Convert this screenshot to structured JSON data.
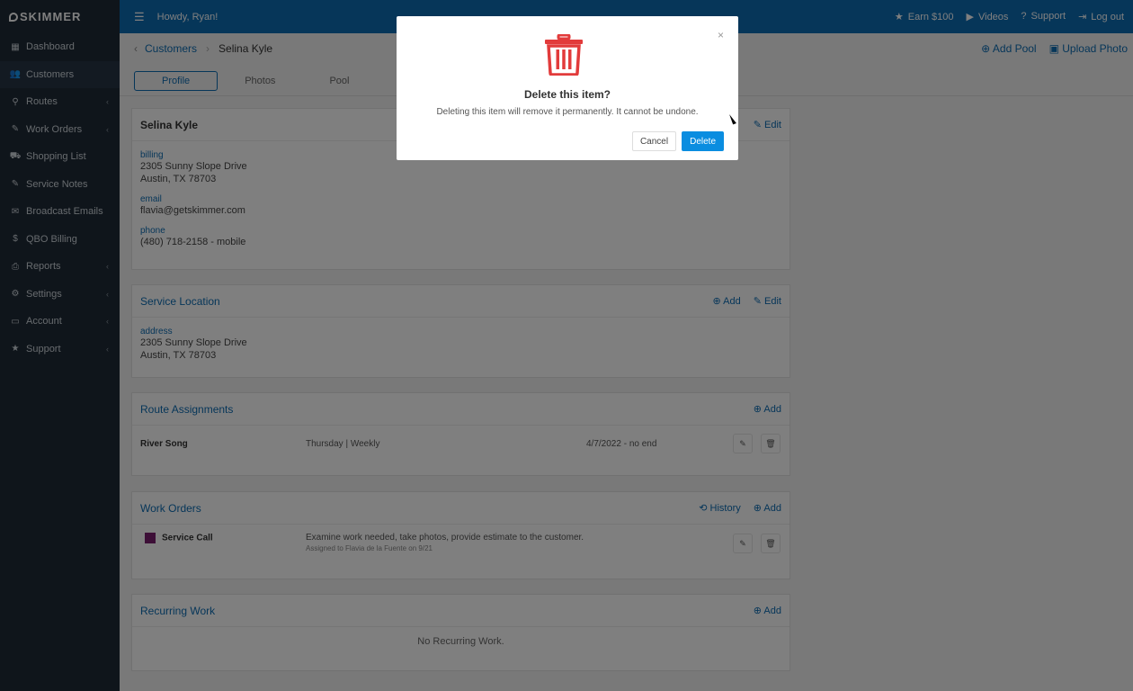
{
  "app": {
    "logo_text": "SKIMMER"
  },
  "sidebar": {
    "items": [
      {
        "label": "Dashboard",
        "icon": "dashboard-icon",
        "glyph": "▦"
      },
      {
        "label": "Customers",
        "icon": "users-icon",
        "glyph": "👥"
      },
      {
        "label": "Routes",
        "icon": "map-pin-icon",
        "glyph": "⚲"
      },
      {
        "label": "Work Orders",
        "icon": "wrench-icon",
        "glyph": "✎"
      },
      {
        "label": "Shopping List",
        "icon": "cart-icon",
        "glyph": "⛟"
      },
      {
        "label": "Service Notes",
        "icon": "edit-icon",
        "glyph": "✎"
      },
      {
        "label": "Broadcast Emails",
        "icon": "envelope-icon",
        "glyph": "✉"
      },
      {
        "label": "QBO Billing",
        "icon": "dollar-icon",
        "glyph": "$"
      },
      {
        "label": "Reports",
        "icon": "printer-icon",
        "glyph": "⎙"
      },
      {
        "label": "Settings",
        "icon": "gear-icon",
        "glyph": "⚙"
      },
      {
        "label": "Account",
        "icon": "card-icon",
        "glyph": "▭"
      },
      {
        "label": "Support",
        "icon": "star-icon",
        "glyph": "★"
      }
    ]
  },
  "topbar": {
    "howdy": "Howdy, Ryan!",
    "earn": "Earn $100",
    "videos": "Videos",
    "support": "Support",
    "logout": "Log out"
  },
  "breadcrumb": {
    "parent": "Customers",
    "current": "Selina Kyle"
  },
  "header_actions": {
    "add_pool": "Add Pool",
    "upload_photo": "Upload Photo"
  },
  "tabs": [
    "Profile",
    "Photos",
    "Pool"
  ],
  "profile": {
    "name": "Selina Kyle",
    "edit": "Edit",
    "billing_label": "billing",
    "billing_line1": "2305 Sunny Slope Drive",
    "billing_line2": "Austin, TX 78703",
    "email_label": "email",
    "email": "flavia@getskimmer.com",
    "phone_label": "phone",
    "phone": "(480) 718-2158 - mobile"
  },
  "service_location": {
    "title": "Service Location",
    "add": "Add",
    "edit": "Edit",
    "address_label": "address",
    "line1": "2305 Sunny Slope Drive",
    "line2": "Austin, TX 78703"
  },
  "route_assignments": {
    "title": "Route Assignments",
    "add": "Add",
    "rows": [
      {
        "tech": "River Song",
        "schedule": "Thursday | Weekly",
        "dates": "4/7/2022 - no end"
      }
    ]
  },
  "work_orders": {
    "title": "Work Orders",
    "history": "History",
    "add": "Add",
    "rows": [
      {
        "type": "Service Call",
        "description": "Examine work needed, take photos, provide estimate to the customer.",
        "assigned": "Assigned to Flavia de la Fuente on 9/21",
        "color": "#7a1f6e"
      }
    ]
  },
  "recurring_work": {
    "title": "Recurring Work",
    "add": "Add",
    "empty": "No Recurring Work."
  },
  "modal": {
    "title": "Delete this item?",
    "message": "Deleting this item will remove it permanently. It cannot be undone.",
    "cancel": "Cancel",
    "delete": "Delete",
    "close": "×",
    "icon_color": "#e23b3b",
    "accent": "#0a8de0"
  }
}
